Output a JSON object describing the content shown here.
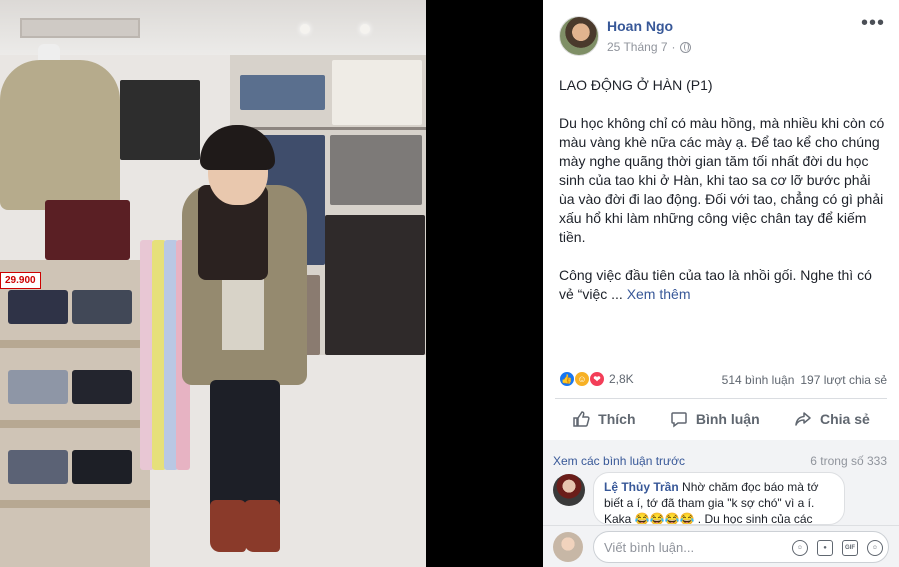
{
  "post": {
    "author": "Hoan Ngo",
    "date": "25 Tháng 7",
    "separator": "·",
    "more_label": "•••",
    "title": "LAO ĐỘNG Ở HÀN (P1)",
    "paragraph1": "Du học không chỉ có màu hồng, mà nhiều khi còn có màu vàng khè nữa các mày ạ. Để tao kể cho chúng mày nghe quãng thời gian tăm tối nhất đời du học sinh của tao khi ở Hàn, khi tao sa cơ lỡ bước phải ùa vào đời đi lao động. Đối với tao, chẳng có gì phải xấu hổ khi làm những công việc chân tay để kiếm tiền.",
    "paragraph2_prefix": "Công việc đầu tiên của tao là nhồi gối. Nghe thì có vẻ “việc ... ",
    "see_more": "Xem thêm"
  },
  "photo": {
    "price_tag": "29.900"
  },
  "stats": {
    "reactions": "2,8K",
    "comments": "514 bình luận",
    "shares": "197 lượt chia sẻ",
    "reaction_icons": [
      "like-icon",
      "haha-icon",
      "love-icon"
    ]
  },
  "actions": {
    "like": "Thích",
    "comment": "Bình luận",
    "share": "Chia sẻ"
  },
  "comments": {
    "view_previous": "Xem các bình luận trước",
    "count": "6 trong số 333",
    "items": [
      {
        "name": "Lệ Thủy Trần",
        "text": "Nhờ chăm đọc báo mà tớ biết a í, tớ đã tham gia \"k sợ chó\" vì a í. Kaka 😂😂😂😂 . Du học sinh của các"
      }
    ],
    "compose_placeholder": "Viết bình luận...",
    "compose_icons": [
      "emoji-icon",
      "camera-icon",
      "gif-icon",
      "sticker-icon"
    ]
  },
  "colors": {
    "link": "#385898",
    "muted": "#90949c",
    "like_blue": "#1877f2",
    "love_red": "#f33e58",
    "haha_yellow": "#f7b125"
  }
}
